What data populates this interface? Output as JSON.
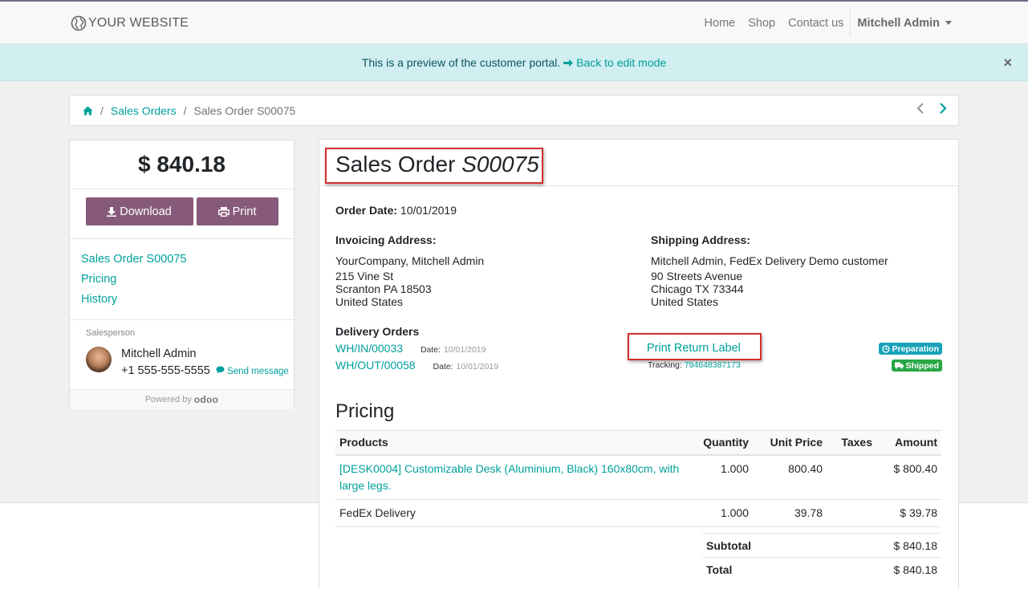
{
  "navbar": {
    "brand": "YOUR WEBSITE",
    "links": [
      "Home",
      "Shop",
      "Contact us"
    ],
    "user": "Mitchell Admin"
  },
  "alert": {
    "text": "This is a preview of the customer portal.",
    "link": "Back to edit mode",
    "close": "×"
  },
  "breadcrumb": {
    "items": [
      "Sales Orders",
      "Sales Order S00075"
    ]
  },
  "sidebar": {
    "amount": "$ 840.18",
    "download_label": "Download",
    "print_label": "Print",
    "links": [
      "Sales Order S00075",
      "Pricing",
      "History"
    ],
    "salesperson_label": "Salesperson",
    "salesperson_name": "Mitchell Admin",
    "salesperson_phone": "+1 555-555-5555",
    "send_message": "Send message",
    "powered_by": "Powered by",
    "powered_brand": "odoo"
  },
  "order": {
    "title": "Sales Order",
    "number": "S00075",
    "date_label": "Order Date:",
    "date": "10/01/2019",
    "invoicing_label": "Invoicing Address:",
    "invoicing": [
      "YourCompany, Mitchell Admin",
      "215 Vine St",
      "Scranton PA 18503",
      "United States"
    ],
    "shipping_label": "Shipping Address:",
    "shipping": [
      "Mitchell Admin, FedEx Delivery Demo customer",
      "90 Streets Avenue",
      "Chicago TX 73344",
      "United States"
    ]
  },
  "delivery": {
    "title": "Delivery Orders",
    "rows": [
      {
        "ref": "WH/IN/00033",
        "date_label": "Date:",
        "date": "10/01/2019",
        "badge": "Preparation"
      },
      {
        "ref": "WH/OUT/00058",
        "date_label": "Date:",
        "date": "10/01/2019",
        "badge": "Shipped"
      }
    ],
    "return_label": "Print Return Label",
    "tracking_label": "Tracking:",
    "tracking_number": "794648387173"
  },
  "pricing": {
    "title": "Pricing",
    "headers": [
      "Products",
      "Quantity",
      "Unit Price",
      "Taxes",
      "Amount"
    ],
    "rows": [
      {
        "product": "[DESK0004] Customizable Desk (Aluminium, Black) 160x80cm, with large legs.",
        "quantity": "1.000",
        "unit_price": "800.40",
        "taxes": "",
        "amount": "$ 800.40"
      },
      {
        "product": "FedEx Delivery",
        "quantity": "1.000",
        "unit_price": "39.78",
        "taxes": "",
        "amount": "$ 39.78"
      }
    ],
    "subtotal_label": "Subtotal",
    "subtotal": "$ 840.18",
    "total_label": "Total",
    "total": "$ 840.18"
  },
  "colors": {
    "accent": "#00a09d",
    "primary_button": "#875a7b",
    "highlight": "#d32f2f",
    "badge_info": "#17a2b8",
    "badge_success": "#28a745"
  }
}
